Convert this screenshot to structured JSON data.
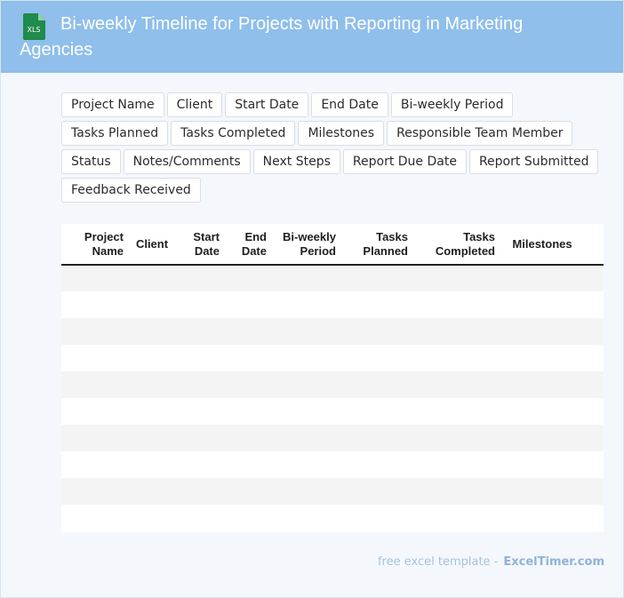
{
  "header": {
    "title": "Bi-weekly Timeline for Projects with Reporting in Marketing Agencies",
    "icon": "xls-file-icon",
    "icon_text": "XLS",
    "icon_color": "#1f8b4c"
  },
  "tags": [
    "Project Name",
    "Client",
    "Start Date",
    "End Date",
    "Bi-weekly Period",
    "Tasks Planned",
    "Tasks Completed",
    "Milestones",
    "Responsible Team Member",
    "Status",
    "Notes/Comments",
    "Next Steps",
    "Report Due Date",
    "Report Submitted",
    "Feedback Received"
  ],
  "table": {
    "columns": [
      {
        "line1": "Project",
        "line2": "Name"
      },
      {
        "line1": "Client",
        "line2": ""
      },
      {
        "line1": "Start",
        "line2": "Date"
      },
      {
        "line1": "End",
        "line2": "Date"
      },
      {
        "line1": "Bi-weekly",
        "line2": "Period"
      },
      {
        "line1": "Tasks",
        "line2": "Planned"
      },
      {
        "line1": "Tasks",
        "line2": "Completed"
      },
      {
        "line1": "Milestones",
        "line2": ""
      },
      {
        "line1": "–",
        "line2": ""
      }
    ],
    "row_count": 10
  },
  "footer": {
    "free_text": "free excel template -",
    "brand": "ExcelTimer.com"
  },
  "colors": {
    "header_bg": "#8fbfea",
    "page_bg": "#f4f8fd",
    "stripe": "#f4f4f4"
  }
}
